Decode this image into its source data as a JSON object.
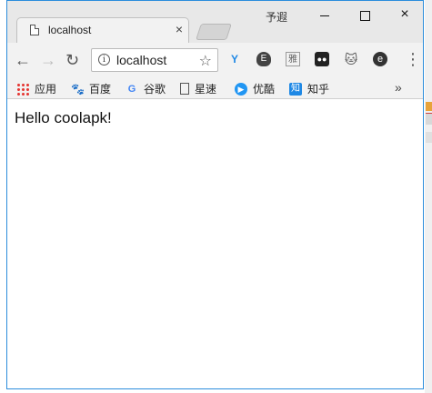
{
  "window": {
    "user_label": "予遐",
    "controls": {
      "minimize": "minimize",
      "maximize": "maximize",
      "close": "×"
    }
  },
  "tab": {
    "title": "localhost",
    "close_label": "×"
  },
  "toolbar": {
    "back": "←",
    "forward": "→",
    "reload": "↻",
    "address": "localhost",
    "info_icon": "i",
    "star_icon": "☆",
    "menu": "⋮",
    "extensions": [
      {
        "name": "vue-devtools",
        "glyph": "Y"
      },
      {
        "name": "evernote",
        "glyph": "E"
      },
      {
        "name": "ya",
        "glyph": "雅"
      },
      {
        "name": "tampermonkey",
        "glyph": "●●"
      },
      {
        "name": "cat",
        "glyph": "🐱"
      },
      {
        "name": "e-ext",
        "glyph": "e"
      }
    ]
  },
  "bookmarks": {
    "items": [
      {
        "label": "应用",
        "icon": "apps-grid"
      },
      {
        "label": "百度",
        "icon": "baidu-paw"
      },
      {
        "label": "谷歌",
        "icon": "google-g",
        "glyph": "G"
      },
      {
        "label": "星速",
        "icon": "page"
      },
      {
        "label": "优酷",
        "icon": "youku-play",
        "glyph": "▶"
      },
      {
        "label": "知乎",
        "icon": "zhihu",
        "glyph": "知"
      }
    ],
    "more": "»"
  },
  "content": {
    "text": "Hello coolapk!"
  },
  "colors": {
    "window_border": "#2c8ddc",
    "chrome": "#f2f2f2"
  }
}
